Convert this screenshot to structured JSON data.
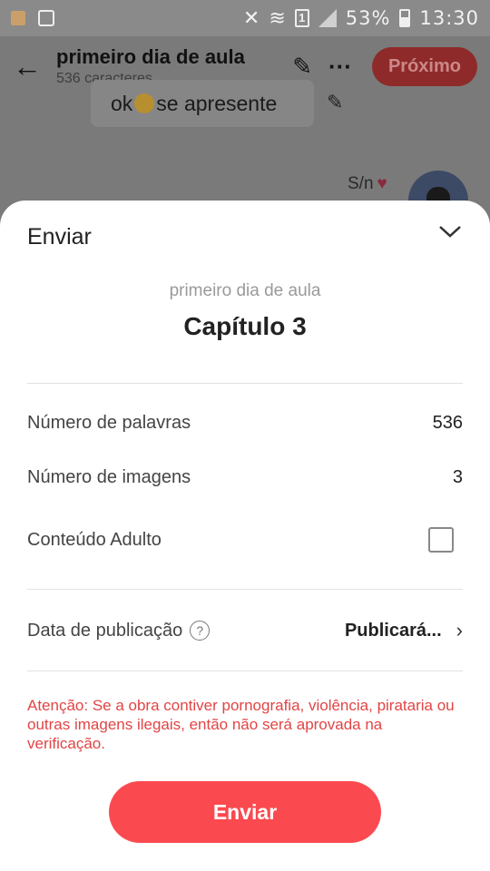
{
  "status_bar": {
    "battery": "53%",
    "time": "13:30",
    "sim": "1"
  },
  "app_bar": {
    "title": "primeiro dia de aula",
    "subtitle": "536 caracteres",
    "next_label": "Próximo"
  },
  "background_content": {
    "bubble_text_before": "ok ",
    "bubble_text_after": "se apresente",
    "author": "S/n"
  },
  "sheet": {
    "title": "Enviar",
    "work_title": "primeiro dia de aula",
    "chapter": "Capítulo 3",
    "word_count_label": "Número de palavras",
    "word_count_value": "536",
    "image_count_label": "Número de imagens",
    "image_count_value": "3",
    "adult_label": "Conteúdo Adulto",
    "adult_checked": false,
    "publish_date_label": "Data de publicação",
    "publish_date_value": "Publicará...",
    "warning": "Atenção: Se a obra contiver pornografia, violência, pirataria ou outras imagens ilegais, então não será aprovada na verificação.",
    "send_label": "Enviar"
  },
  "colors": {
    "accent": "#fb4a4f",
    "warning": "#e14545"
  }
}
